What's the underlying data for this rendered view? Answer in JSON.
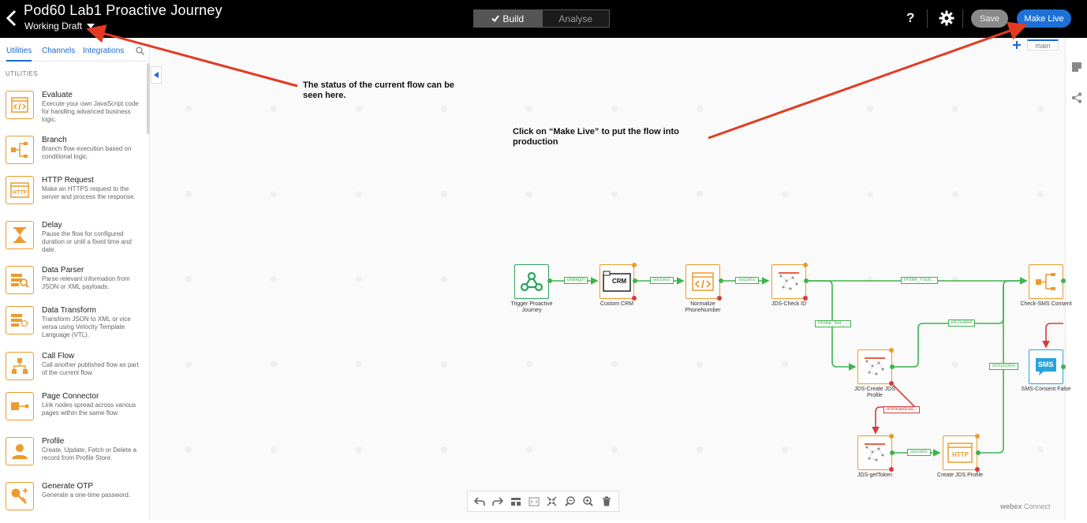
{
  "header": {
    "title": "Pod60 Lab1 Proactive Journey",
    "status": "Working Draft",
    "modes": [
      "Build",
      "Analyse"
    ],
    "help": "?",
    "save_label": "Save",
    "make_live_label": "Make Live"
  },
  "sidebar": {
    "tabs": [
      "Utilities",
      "Channels",
      "Integrations"
    ],
    "section": "UTILITIES",
    "items": [
      {
        "title": "Evaluate",
        "desc": "Execute your own JavaScript code for handling advanced business logic."
      },
      {
        "title": "Branch",
        "desc": "Branch flow execution based on conditional logic."
      },
      {
        "title": "HTTP Request",
        "desc": "Make an HTTPS request to the server and process the response."
      },
      {
        "title": "Delay",
        "desc": "Pause the flow for configured duration or until a fixed time and date."
      },
      {
        "title": "Data Parser",
        "desc": "Parse relevant information from JSON or XML payloads."
      },
      {
        "title": "Data Transform",
        "desc": "Transform JSON to XML or vice versa using Velocity Template Language (VTL)."
      },
      {
        "title": "Call Flow",
        "desc": "Call another published flow as part of the current flow."
      },
      {
        "title": "Page Connector",
        "desc": "Link nodes spread across various pages within the same flow."
      },
      {
        "title": "Profile",
        "desc": "Create, Update, Fetch or Delete a record from Profile Store."
      },
      {
        "title": "Generate OTP",
        "desc": "Generate a one-time password."
      }
    ]
  },
  "canvas": {
    "page_tab": "main",
    "annotations": [
      "The status of the current flow can be seen here.",
      "Click on “Make Live” to put the flow into production"
    ],
    "nodes": [
      {
        "id": "trigger",
        "label": "Trigger Proactive Journey"
      },
      {
        "id": "crm",
        "label": "Custom CRM",
        "icon_text": "CRM"
      },
      {
        "id": "normalize",
        "label": "Normalize PhoneNumber"
      },
      {
        "id": "check",
        "label": "JDS-Check ID"
      },
      {
        "id": "check-sms",
        "label": "Check-SMS Consent"
      },
      {
        "id": "create-profile",
        "label": "JDS-Create JDS Profile"
      },
      {
        "id": "sms-consent",
        "label": "SMS-Consent False",
        "icon_text": "SMS"
      },
      {
        "id": "gettoken",
        "label": "JDS-getToken"
      },
      {
        "id": "create-http",
        "label": "Create JDS Profile",
        "icon_text": "HTTP"
      }
    ],
    "edge_labels": [
      "onBegin",
      "success",
      "success",
      "Profile_Foun...",
      "Profile_Not_...",
      "idCreated",
      "onSuccess",
      "onInvalidDat...",
      "success"
    ],
    "brand": {
      "bold": "webex",
      "rest": "Connect"
    }
  },
  "colors": {
    "accent": "#1d71d6",
    "node_orange": "#ec9b2e",
    "edge_green": "#3fb34f",
    "edge_red": "#d63c3c",
    "trigger_green": "#27a55a",
    "annotation_arrow": "#e23b22"
  }
}
